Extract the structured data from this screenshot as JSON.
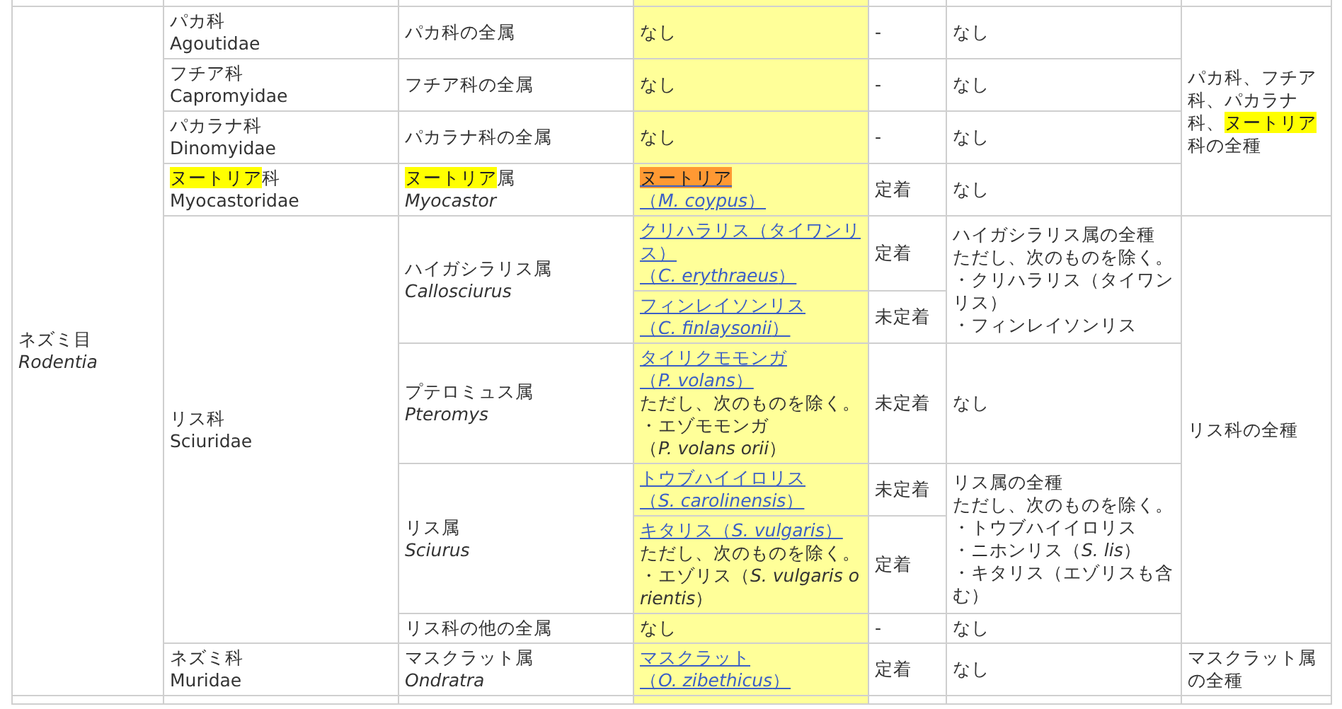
{
  "order": {
    "name": "ネズミ目",
    "latin": "Rodentia",
    "groups": [
      {
        "scope": [
          {
            "text": "パカ科、フチア科、パカラナ科、"
          },
          {
            "text": "ヌートリア",
            "color": "#ffff00"
          },
          {
            "text": "科の全種"
          }
        ],
        "families": [
          {
            "name": "パカ科",
            "latin": "Agoutidae",
            "genera": [
              {
                "name": "パカ科の全属",
                "rules": [
                  {
                    "exclusion": [
                      "なし"
                    ],
                    "species": [
                      {
                        "lines": [
                          {
                            "kind": "text",
                            "text": "なし"
                          }
                        ],
                        "status": "-"
                      }
                    ]
                  }
                ]
              }
            ]
          },
          {
            "name": "フチア科",
            "latin": "Capromyidae",
            "genera": [
              {
                "name": "フチア科の全属",
                "rules": [
                  {
                    "exclusion": [
                      "なし"
                    ],
                    "species": [
                      {
                        "lines": [
                          {
                            "kind": "text",
                            "text": "なし"
                          }
                        ],
                        "status": "-"
                      }
                    ]
                  }
                ]
              }
            ]
          },
          {
            "name": "パカラナ科",
            "latin": "Dinomyidae",
            "genera": [
              {
                "name": "パカラナ科の全属",
                "rules": [
                  {
                    "exclusion": [
                      "なし"
                    ],
                    "species": [
                      {
                        "lines": [
                          {
                            "kind": "text",
                            "text": "なし"
                          }
                        ],
                        "status": "-"
                      }
                    ]
                  }
                ]
              }
            ]
          },
          {
            "name": [
              {
                "text": "ヌートリア",
                "color": "#ffff00"
              },
              {
                "text": "科"
              }
            ],
            "latin": "Myocastoridae",
            "genera": [
              {
                "name": [
                  {
                    "text": "ヌートリア",
                    "color": "#ffff00"
                  },
                  {
                    "text": "属"
                  }
                ],
                "latin": "Myocastor",
                "rules": [
                  {
                    "exclusion": [
                      "なし"
                    ],
                    "species": [
                      {
                        "lines": [
                          {
                            "kind": "link",
                            "text": [
                              {
                                "text": "ヌートリア",
                                "color": "#ff9933"
                              }
                            ]
                          },
                          {
                            "kind": "link",
                            "text": "（*M. coypus*）"
                          }
                        ],
                        "status": "定着"
                      }
                    ]
                  }
                ]
              }
            ]
          }
        ]
      },
      {
        "scope": "リス科の全種",
        "families": [
          {
            "name": "リス科",
            "latin": "Sciuridae",
            "genera": [
              {
                "name": "ハイガシラリス属",
                "latin": "Callosciurus",
                "rules": [
                  {
                    "exclusion": [
                      "ハイガシラリス属の全種",
                      "ただし、次のものを除く。",
                      "・クリハラリス（タイワンリス）",
                      "・フィンレイソンリス"
                    ],
                    "species": [
                      {
                        "lines": [
                          {
                            "kind": "link",
                            "text": "クリハラリス（タイワンリス）"
                          },
                          {
                            "kind": "link",
                            "text": "（*C. erythraeus*）"
                          }
                        ],
                        "status": "定着"
                      },
                      {
                        "lines": [
                          {
                            "kind": "link",
                            "text": "フィンレイソンリス"
                          },
                          {
                            "kind": "link",
                            "text": "（*C. finlaysonii*）"
                          }
                        ],
                        "status": "未定着"
                      }
                    ]
                  }
                ]
              },
              {
                "name": "プテロミュス属",
                "latin": "Pteromys",
                "rules": [
                  {
                    "exclusion": [
                      "なし"
                    ],
                    "species": [
                      {
                        "lines": [
                          {
                            "kind": "link",
                            "text": "タイリクモモンガ"
                          },
                          {
                            "kind": "link",
                            "text": "（*P. volans*）"
                          },
                          {
                            "kind": "text",
                            "text": "ただし、次のものを除く。"
                          },
                          {
                            "kind": "text",
                            "text": "・エゾモモンガ"
                          },
                          {
                            "kind": "text",
                            "text": "（*P. volans orii*）"
                          }
                        ],
                        "status": "未定着"
                      }
                    ]
                  }
                ]
              },
              {
                "name": "リス属",
                "latin": "Sciurus",
                "rules": [
                  {
                    "exclusion": [
                      "リス属の全種",
                      "ただし、次のものを除く。",
                      "・トウブハイイロリス",
                      "・ニホンリス（*S. lis*）",
                      "・キタリス（エゾリスも含む）"
                    ],
                    "species": [
                      {
                        "lines": [
                          {
                            "kind": "link",
                            "text": "トウブハイイロリス"
                          },
                          {
                            "kind": "link",
                            "text": "（*S. carolinensis*）"
                          }
                        ],
                        "status": "未定着"
                      },
                      {
                        "lines": [
                          {
                            "kind": "link",
                            "text": "キタリス（*S. vulgaris*）"
                          },
                          {
                            "kind": "text",
                            "text": "ただし、次のものを除く。"
                          },
                          {
                            "kind": "text",
                            "text": "・エゾリス（*S. vulgaris orientis*）"
                          }
                        ],
                        "status": "定着"
                      }
                    ]
                  }
                ]
              },
              {
                "name": "リス科の他の全属",
                "rules": [
                  {
                    "exclusion": [
                      "なし"
                    ],
                    "species": [
                      {
                        "lines": [
                          {
                            "kind": "text",
                            "text": "なし"
                          }
                        ],
                        "status": "-"
                      }
                    ]
                  }
                ]
              }
            ]
          }
        ]
      },
      {
        "scope": "マスクラット属の全種",
        "families": [
          {
            "name": "ネズミ科",
            "latin": "Muridae",
            "genera": [
              {
                "name": "マスクラット属",
                "latin": "Ondratra",
                "rules": [
                  {
                    "exclusion": [
                      "なし"
                    ],
                    "species": [
                      {
                        "lines": [
                          {
                            "kind": "link",
                            "text": "マスクラット"
                          },
                          {
                            "kind": "link",
                            "text": "（*O. zibethicus*）"
                          }
                        ],
                        "status": "定着"
                      }
                    ]
                  }
                ]
              }
            ]
          }
        ]
      }
    ]
  }
}
